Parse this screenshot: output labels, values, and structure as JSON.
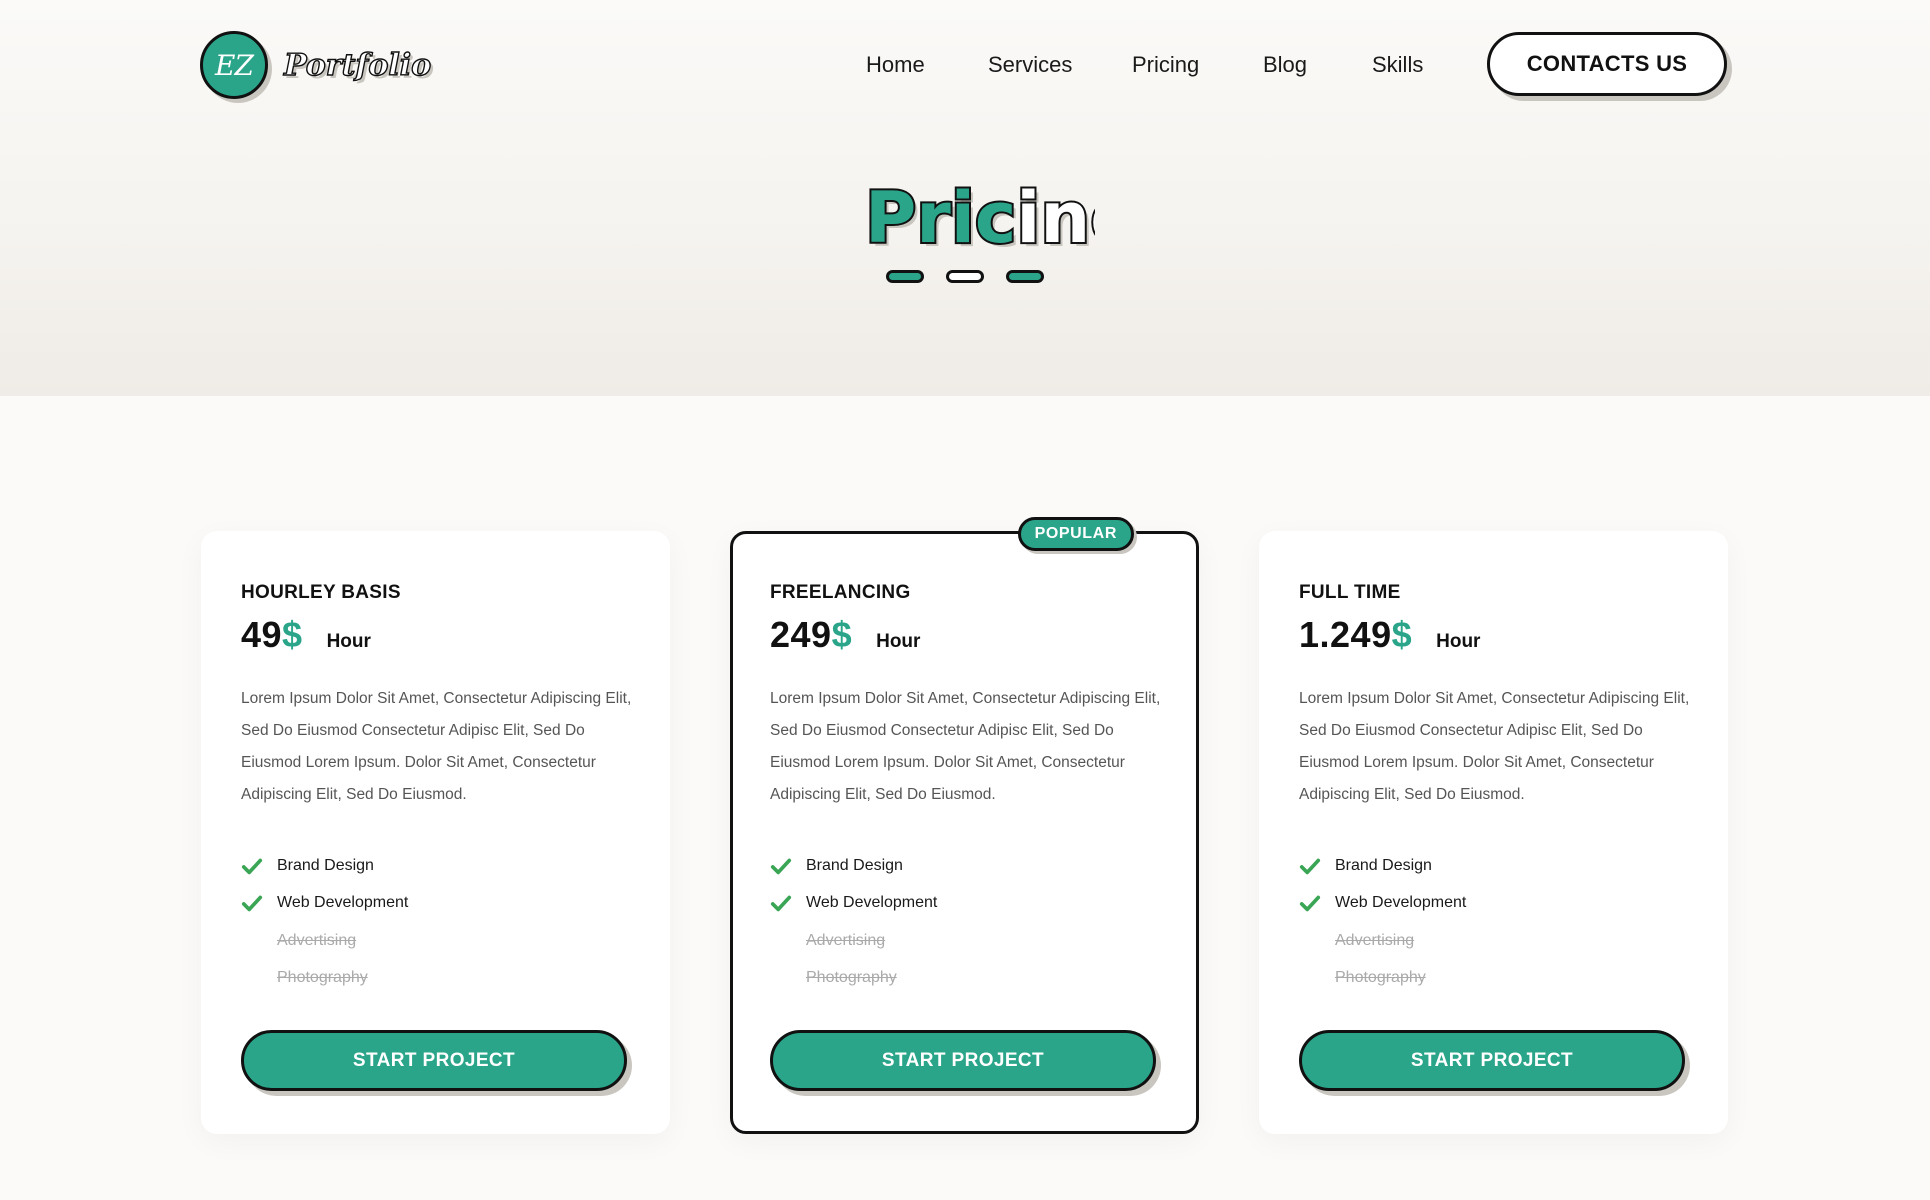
{
  "brand": {
    "logo_badge": "EZ",
    "logo_word": "Portfolio",
    "accent_color": "#2aa58a"
  },
  "nav": {
    "items": [
      "Home",
      "Services",
      "Pricing",
      "Blog",
      "Skills"
    ],
    "contact_label": "CONTACTS US"
  },
  "section": {
    "title_part1": "Pric",
    "title_part2": "ing"
  },
  "plans": [
    {
      "name": "HOURLEY BASIS",
      "price": "49",
      "currency": "$",
      "unit": "Hour",
      "description": "Lorem Ipsum Dolor Sit Amet, Consectetur Adipiscing Elit, Sed Do Eiusmod Consectetur Adipisc Elit, Sed Do Eiusmod Lorem Ipsum. Dolor Sit Amet, Consectetur Adipiscing Elit, Sed Do Eiusmod.",
      "features": [
        {
          "label": "Brand Design",
          "included": true
        },
        {
          "label": "Web Development",
          "included": true
        },
        {
          "label": "Advertising",
          "included": false
        },
        {
          "label": "Photography",
          "included": false
        }
      ],
      "button": "START PROJECT",
      "popular": false
    },
    {
      "name": "FREELANCING",
      "price": "249",
      "currency": "$",
      "unit": "Hour",
      "description": "Lorem Ipsum Dolor Sit Amet, Consectetur Adipiscing Elit, Sed Do Eiusmod Consectetur Adipisc Elit, Sed Do Eiusmod Lorem Ipsum. Dolor Sit Amet, Consectetur Adipiscing Elit, Sed Do Eiusmod.",
      "features": [
        {
          "label": "Brand Design",
          "included": true
        },
        {
          "label": "Web Development",
          "included": true
        },
        {
          "label": "Advertising",
          "included": false
        },
        {
          "label": "Photography",
          "included": false
        }
      ],
      "button": "START PROJECT",
      "popular": true,
      "badge": "POPULAR"
    },
    {
      "name": "FULL TIME",
      "price": "1.249",
      "currency": "$",
      "unit": "Hour",
      "description": "Lorem Ipsum Dolor Sit Amet, Consectetur Adipiscing Elit, Sed Do Eiusmod Consectetur Adipisc Elit, Sed Do Eiusmod Lorem Ipsum. Dolor Sit Amet, Consectetur Adipiscing Elit, Sed Do Eiusmod.",
      "features": [
        {
          "label": "Brand Design",
          "included": true
        },
        {
          "label": "Web Development",
          "included": true
        },
        {
          "label": "Advertising",
          "included": false
        },
        {
          "label": "Photography",
          "included": false
        }
      ],
      "button": "START PROJECT",
      "popular": false
    }
  ]
}
